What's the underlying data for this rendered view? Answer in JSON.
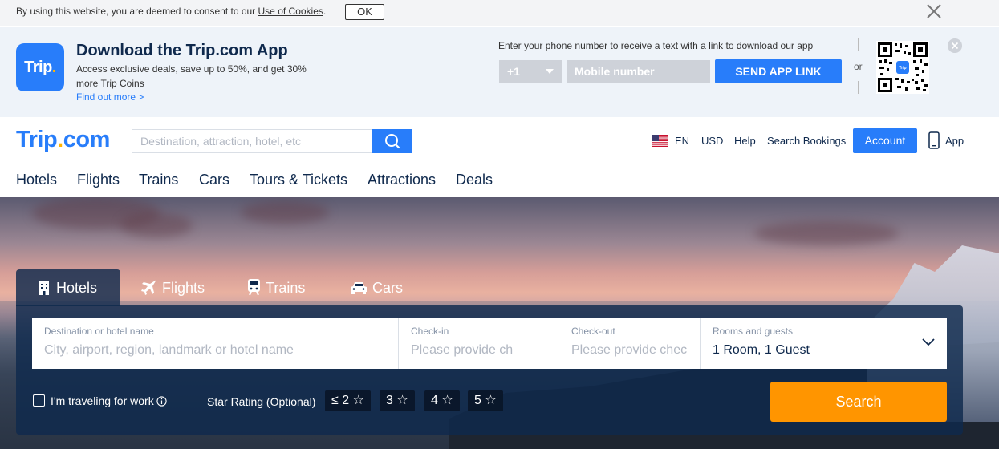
{
  "cookie": {
    "text": "By using this website, you are deemed to consent to our ",
    "link": "Use of Cookies",
    "period": ".",
    "ok_label": "OK"
  },
  "app_banner": {
    "logo_text": "Trip",
    "logo_dot": ".",
    "title": "Download the Trip.com App",
    "description": "Access exclusive deals, save up to 50%, and get 30% more Trip Coins",
    "find_out_more": "Find out more >",
    "phone_prompt": "Enter your phone number to receive a text with a link to download our app",
    "country_code": "+1",
    "mobile_placeholder": "Mobile number",
    "send_label": "SEND APP LINK",
    "or_label": "or",
    "qr_logo": "Trip"
  },
  "header": {
    "logo_main": "Trip",
    "logo_dot": ".",
    "logo_suffix": "com",
    "search_placeholder": "Destination, attraction, hotel, etc",
    "language": "EN",
    "currency": "USD",
    "help": "Help",
    "search_bookings": "Search Bookings",
    "account": "Account",
    "app": "App"
  },
  "nav": [
    {
      "label": "Hotels"
    },
    {
      "label": "Flights"
    },
    {
      "label": "Trains"
    },
    {
      "label": "Cars"
    },
    {
      "label": "Tours & Tickets"
    },
    {
      "label": "Attractions"
    },
    {
      "label": "Deals"
    }
  ],
  "search_tabs": [
    {
      "label": "Hotels",
      "icon": "hotel-icon",
      "active": true
    },
    {
      "label": "Flights",
      "icon": "plane-icon",
      "active": false
    },
    {
      "label": "Trains",
      "icon": "train-icon",
      "active": false
    },
    {
      "label": "Cars",
      "icon": "car-icon",
      "active": false
    }
  ],
  "search_form": {
    "destination_label": "Destination or hotel name",
    "destination_placeholder": "City, airport, region, landmark or hotel name",
    "checkin_label": "Check-in",
    "checkin_placeholder": "Please provide ch",
    "checkout_label": "Check-out",
    "checkout_placeholder": "Please provide chec",
    "rooms_label": "Rooms and guests",
    "rooms_value": "1 Room, 1 Guest",
    "work_label": "I'm traveling for work",
    "star_label": "Star Rating (Optional)",
    "star_options": [
      "≤ 2 ☆",
      "3 ☆",
      "4 ☆",
      "5 ☆"
    ],
    "search_label": "Search"
  },
  "colors": {
    "brand": "#287dfa",
    "accent": "#ff9500",
    "logo_dot": "#ffb400",
    "text": "#0f294d"
  }
}
